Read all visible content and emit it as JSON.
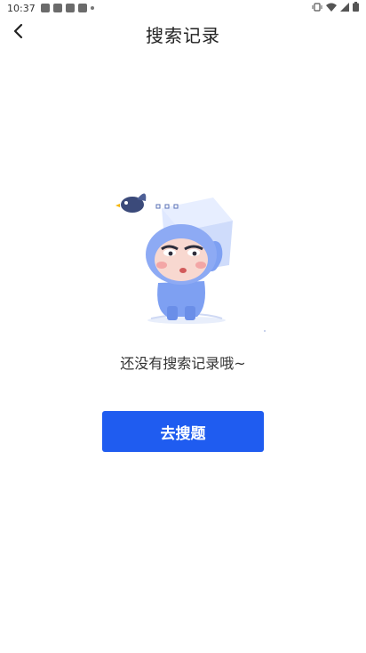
{
  "status_bar": {
    "time": "10:37",
    "left_icons": [
      "notification-icon",
      "notification-icon",
      "notification-icon",
      "a-icon",
      "dot-icon"
    ],
    "right_icons": [
      "vibrate-icon",
      "wifi-icon",
      "signal-icon",
      "battery-icon"
    ]
  },
  "header": {
    "title": "搜索记录",
    "back_icon": "chevron-left-icon"
  },
  "empty_state": {
    "message": "还没有搜索记录哦~",
    "illustration": "character-with-box-illustration"
  },
  "cta": {
    "label": "去搜题",
    "color": "#1f5cf0"
  }
}
